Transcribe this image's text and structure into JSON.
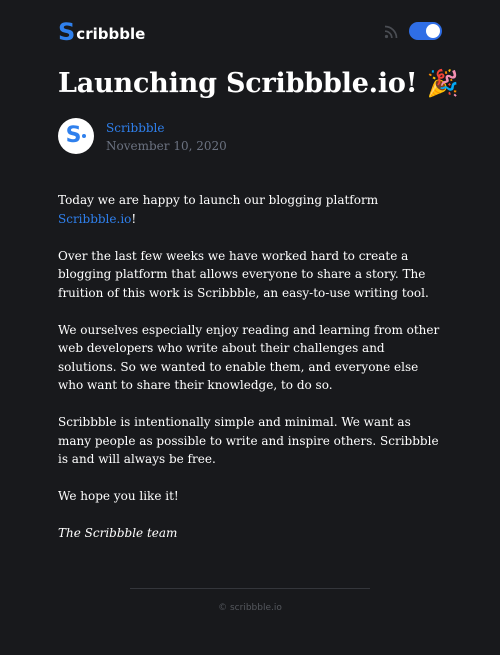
{
  "header": {
    "logo_first": "S",
    "logo_rest": "cribbble",
    "rss_icon": "rss-icon",
    "theme_toggle_state": "on",
    "accent": "#2f80ed"
  },
  "post": {
    "title": "Launching Scribbble.io!",
    "title_emoji": "🎉",
    "author_avatar_letter": "S",
    "author_name": "Scribbble",
    "date": "November 10, 2020",
    "p1_before": "Today we are happy to launch our blogging platform ",
    "p1_link": "Scribbble.io",
    "p1_after": "!",
    "p2": "Over the last few weeks we have worked hard to create a blogging platform that allows everyone to share a story. The fruition of this work is Scribbble, an easy-to-use writing tool.",
    "p3": "We ourselves especially enjoy reading and learning from other web developers who write about their challenges and solutions. So we wanted to enable them, and everyone else who want to share their knowledge, to do so.",
    "p4": "Scribbble is intentionally simple and minimal. We want as many people as possible to write and inspire others. Scribbble is and will always be free.",
    "p5": "We hope you like it!",
    "signoff": "The Scribbble team"
  },
  "footer": {
    "text": "© scribbble.io"
  }
}
